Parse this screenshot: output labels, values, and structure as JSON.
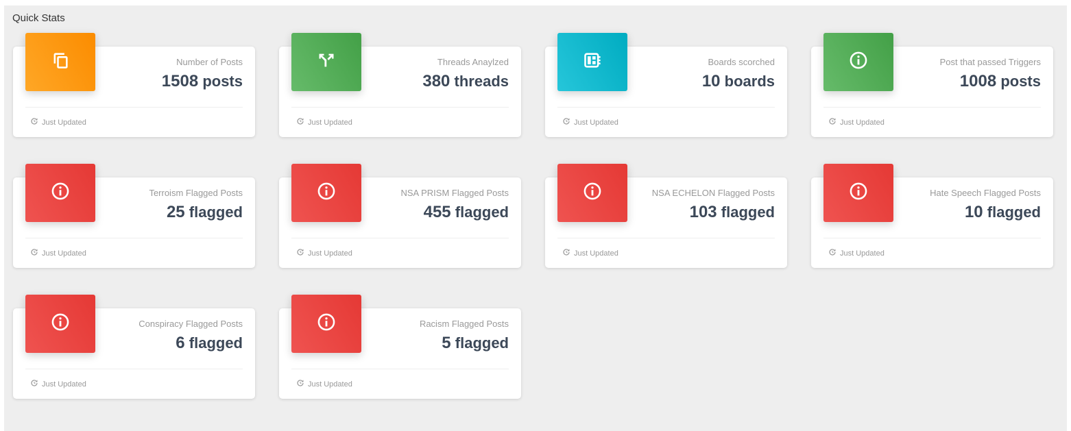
{
  "section": {
    "title": "Quick Stats"
  },
  "cards": [
    {
      "category": "Number of Posts",
      "number": "1508",
      "unit": "posts",
      "footer": "Just Updated",
      "color": "#fb8c00",
      "icon": "copy-icon"
    },
    {
      "category": "Threads Anaylzed",
      "number": "380",
      "unit": "threads",
      "footer": "Just Updated",
      "color": "#43a047",
      "icon": "call-split-icon"
    },
    {
      "category": "Boards scorched",
      "number": "10",
      "unit": "boards",
      "footer": "Just Updated",
      "color": "#00acc1",
      "icon": "developer-board-icon"
    },
    {
      "category": "Post that passed Triggers",
      "number": "1008",
      "unit": "posts",
      "footer": "Just Updated",
      "color": "#43a047",
      "icon": "info-icon"
    },
    {
      "category": "Terroism Flagged Posts",
      "number": "25",
      "unit": "flagged",
      "footer": "Just Updated",
      "color": "#e53935",
      "icon": "info-icon"
    },
    {
      "category": "NSA PRISM Flagged Posts",
      "number": "455",
      "unit": "flagged",
      "footer": "Just Updated",
      "color": "#e53935",
      "icon": "info-icon"
    },
    {
      "category": "NSA ECHELON Flagged Posts",
      "number": "103",
      "unit": "flagged",
      "footer": "Just Updated",
      "color": "#e53935",
      "icon": "info-icon"
    },
    {
      "category": "Hate Speech Flagged Posts",
      "number": "10",
      "unit": "flagged",
      "footer": "Just Updated",
      "color": "#e53935",
      "icon": "info-icon"
    },
    {
      "category": "Conspiracy Flagged Posts",
      "number": "6",
      "unit": "flagged",
      "footer": "Just Updated",
      "color": "#e53935",
      "icon": "info-icon"
    },
    {
      "category": "Racism Flagged Posts",
      "number": "5",
      "unit": "flagged",
      "footer": "Just Updated",
      "color": "#e53935",
      "icon": "info-icon"
    }
  ]
}
